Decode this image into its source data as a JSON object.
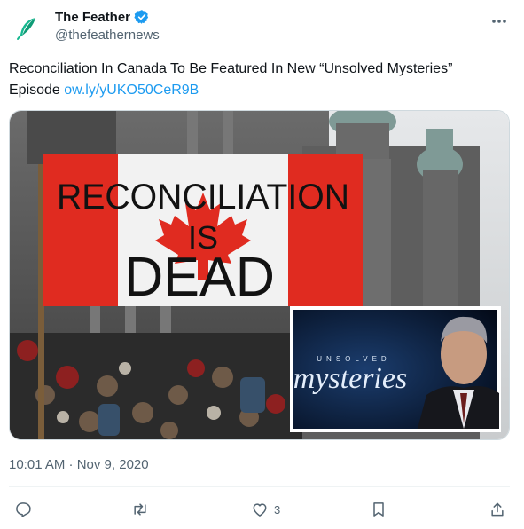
{
  "author": {
    "name": "The Feather",
    "handle": "@thefeathernews",
    "verified_icon": "verified-badge-icon",
    "avatar_icon": "feather-icon",
    "accent": "#1d9bf0"
  },
  "tweet": {
    "text": "Reconciliation In Canada To Be Featured In New “Unsolved Mysteries” Episode",
    "link": "ow.ly/yUKO50CeR9B",
    "timestamp": "10:01 AM · Nov 9, 2020"
  },
  "media": {
    "banner_line1": "RECONCILIATION",
    "banner_line2": "IS",
    "banner_line3": "DEAD",
    "inset_title_top": "UNSOLVED",
    "inset_title_main": "mysteries"
  },
  "actions": {
    "reply_icon": "reply-icon",
    "retweet_icon": "retweet-icon",
    "like_icon": "heart-icon",
    "like_count": "3",
    "bookmark_icon": "bookmark-icon",
    "share_icon": "share-icon"
  }
}
